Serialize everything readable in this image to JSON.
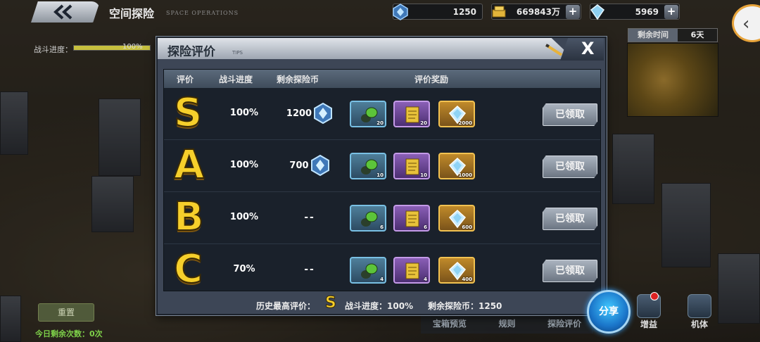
{
  "topbar": {
    "page_title": "空间探险",
    "page_subtitle": "SPACE OPERATIONS",
    "resources": [
      {
        "icon": "crystal-icon",
        "value": "1250",
        "has_plus": false
      },
      {
        "icon": "gold-bars-icon",
        "value": "669843万",
        "has_plus": true
      },
      {
        "icon": "diamond-icon",
        "value": "5969",
        "has_plus": true
      }
    ]
  },
  "left_panel": {
    "progress_label": "战斗进度：",
    "progress_value": "100%",
    "progress_fraction": 1.0,
    "button_label": "重置",
    "daily_text": "今日剩余次数：0次"
  },
  "right_panel": {
    "remaining_time_label": "剩余时间",
    "remaining_time_value": "6天"
  },
  "modal": {
    "title": "探险评价",
    "tips": "TIPS",
    "close_label": "X",
    "headers": [
      "评价",
      "战斗进度",
      "剩余探险币",
      "评价奖励"
    ],
    "rows": [
      {
        "grade": "S",
        "progress": "100%",
        "coins": "1200",
        "has_gem": true,
        "rewards": [
          {
            "type": "green",
            "icon": "battery-icon",
            "count": "20"
          },
          {
            "type": "purple",
            "icon": "scroll-icon",
            "count": "20"
          },
          {
            "type": "gold",
            "icon": "diamond-icon",
            "count": "2000"
          }
        ],
        "claim_label": "已领取"
      },
      {
        "grade": "A",
        "progress": "100%",
        "coins": "700",
        "has_gem": true,
        "rewards": [
          {
            "type": "green",
            "icon": "battery-icon",
            "count": "10"
          },
          {
            "type": "purple",
            "icon": "scroll-icon",
            "count": "10"
          },
          {
            "type": "gold",
            "icon": "diamond-icon",
            "count": "1000"
          }
        ],
        "claim_label": "已领取"
      },
      {
        "grade": "B",
        "progress": "100%",
        "coins": "--",
        "has_gem": false,
        "rewards": [
          {
            "type": "green",
            "icon": "battery-icon",
            "count": "6"
          },
          {
            "type": "purple",
            "icon": "scroll-icon",
            "count": "6"
          },
          {
            "type": "gold",
            "icon": "diamond-icon",
            "count": "600"
          }
        ],
        "claim_label": "已领取"
      },
      {
        "grade": "C",
        "progress": "70%",
        "coins": "--",
        "has_gem": false,
        "rewards": [
          {
            "type": "green",
            "icon": "battery-icon",
            "count": "4"
          },
          {
            "type": "purple",
            "icon": "scroll-icon",
            "count": "4"
          },
          {
            "type": "gold",
            "icon": "diamond-icon",
            "count": "400"
          }
        ],
        "claim_label": "已领取"
      }
    ],
    "footer": {
      "best_label": "历史最高评价：",
      "best_grade": "S",
      "progress_text": "战斗进度：100%",
      "coins_text": "剩余探险币：1250"
    }
  },
  "bottom": {
    "tabs": [
      "宝箱预览",
      "规则",
      "探险评价"
    ],
    "share_label": "分享",
    "side_icons": [
      {
        "icon": "boost-icon",
        "label": "增益"
      },
      {
        "icon": "mecha-icon",
        "label": "机体"
      }
    ]
  },
  "colors": {
    "grade_gold": "#f6cf2b",
    "panel_bg": "#3d4656",
    "share_blue": "#1a74c8"
  }
}
